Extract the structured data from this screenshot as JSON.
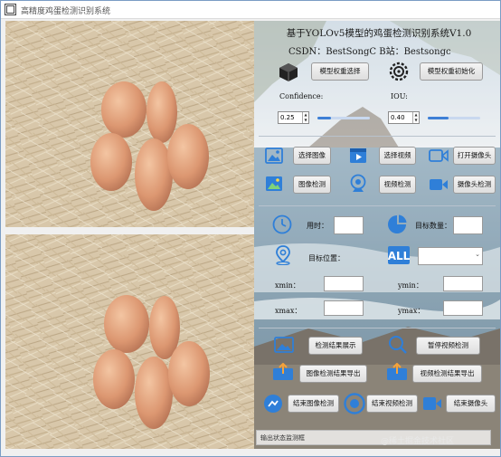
{
  "window": {
    "title": "高精度鸡蛋检测识别系统"
  },
  "header": {
    "title": "基于YOLOv5模型的鸡蛋检测识别系统V1.0",
    "credits": "CSDN：BestSongC  B站：Bestsongc"
  },
  "model": {
    "select_label": "模型权重选择",
    "init_label": "模型权重初始化"
  },
  "params": {
    "confidence_label": "Confidence:",
    "confidence_value": "0.25",
    "confidence_level": 0.25,
    "iou_label": "IOU:",
    "iou_value": "0.40",
    "iou_level": 0.4
  },
  "actions": {
    "select_image": "选择图像",
    "select_video": "选择视频",
    "open_camera": "打开摄像头",
    "image_detect": "图像检测",
    "video_detect": "视频检测",
    "camera_detect": "摄像头检测"
  },
  "stats": {
    "time_label": "用时：",
    "count_label": "目标数量：",
    "position_label": "目标位置：",
    "xmin_label": "xmin：",
    "ymin_label": "ymin：",
    "xmax_label": "xmax：",
    "ymax_label": "ymax："
  },
  "results": {
    "show_result": "检测结果展示",
    "pause_video": "暂停视频检测",
    "export_image": "图像检测结果导出",
    "export_video": "视频检测结果导出",
    "end_image": "结束图像检测",
    "end_video": "结束视频检测",
    "end_camera": "结束摄像头"
  },
  "status": {
    "text": "输出状态监测框"
  },
  "watermark": "@稀土掘金技术社区",
  "colors": {
    "accent": "#3d7fd6",
    "icon_blue": "#2f7fd8"
  }
}
